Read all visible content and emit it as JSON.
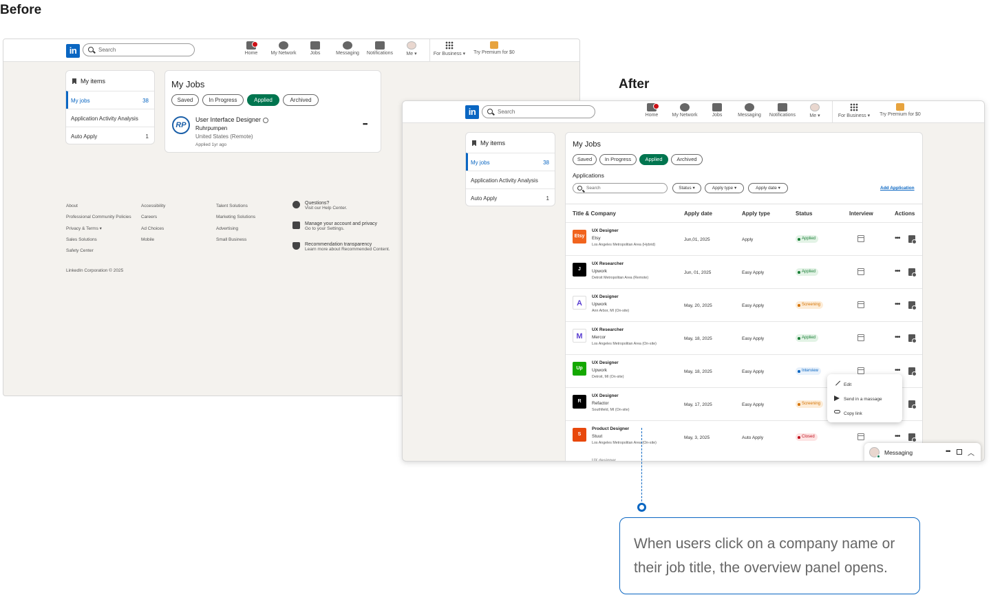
{
  "labels": {
    "before": "Before",
    "after": "After"
  },
  "nav": {
    "search_placeholder": "Search",
    "items": [
      "Home",
      "My Network",
      "Jobs",
      "Messaging",
      "Notifications",
      "Me",
      "For Business",
      "Try Premium for $0"
    ]
  },
  "sidebar": {
    "header": "My items",
    "items": [
      {
        "label": "My jobs",
        "count": "38"
      },
      {
        "label": "Application Activity Analysis",
        "count": ""
      },
      {
        "label": "Auto Apply",
        "count": "1"
      }
    ]
  },
  "jobs": {
    "title": "My Jobs",
    "tabs": [
      "Saved",
      "In Progress",
      "Applied",
      "Archived"
    ],
    "active_tab": "Applied"
  },
  "before_job": {
    "logo_text": "RP",
    "title": "User Interface Designer",
    "company": "Ruhrpumpen",
    "location": "United States (Remote)",
    "applied": "Applied 1yr ago",
    "more": "•••"
  },
  "footer": {
    "col1": [
      "About",
      "Professional Community Policies",
      "Privacy & Terms",
      "Sales Solutions",
      "Safety Center"
    ],
    "col2": [
      "Accessibility",
      "Careers",
      "Ad Choices",
      "Mobile"
    ],
    "col3": [
      "Talent Solutions",
      "Marketing Solutions",
      "Advertising",
      "Small Business"
    ],
    "help": [
      {
        "title": "Questions?",
        "sub": "Visit our Help Center."
      },
      {
        "title": "Manage your account and privacy",
        "sub": "Go to your Settings."
      },
      {
        "title": "Recommendation transparency",
        "sub": "Learn more about Recommended Content."
      }
    ],
    "copyright": "LinkedIn Corporation © 2025"
  },
  "applications": {
    "heading": "Applications",
    "search_placeholder": "Search",
    "filters": [
      "Status",
      "Apply type",
      "Apply date"
    ],
    "add_link": "Add Application",
    "columns": [
      "Title & Company",
      "Apply date",
      "Apply type",
      "Status",
      "Interview",
      "Actions"
    ],
    "rows": [
      {
        "logo": "Etsy",
        "logo_color": "#f1641e",
        "title": "UX Designer",
        "company": "Etsy",
        "location": "Los Angeles Metropolitan Area (Hybrid)",
        "date": "Jun,01, 2025",
        "type": "Apply",
        "status": "Applied",
        "status_kind": "applied"
      },
      {
        "logo": "J",
        "logo_color": "#000000",
        "title": "UX Researcher",
        "company": "Upwork",
        "location": "Detroit Metropolitan Area (Remote)",
        "date": "Jun, 01, 2025",
        "type": "Easy Apply",
        "status": "Applied",
        "status_kind": "applied"
      },
      {
        "logo": "A",
        "logo_color": "#ffffff",
        "title": "UX Designer",
        "company": "Upwork",
        "location": "Ann Arbor, MI  (On-site)",
        "date": "May, 20, 2025",
        "type": "Easy Apply",
        "status": "Screening",
        "status_kind": "screen"
      },
      {
        "logo": "M",
        "logo_color": "#ffffff",
        "title": "UX Researcher",
        "company": "Mercor",
        "location": "Los Angeles Metropolitan Area (On-site)",
        "date": "May, 18, 2025",
        "type": "Easy Apply",
        "status": "Applied",
        "status_kind": "applied"
      },
      {
        "logo": "Up",
        "logo_color": "#14a800",
        "title": "UX Designer",
        "company": "Upwork",
        "location": "Detroit, MI (On-site)",
        "date": "May, 18, 2025",
        "type": "Easy Apply",
        "status": "Interview",
        "status_kind": "int"
      },
      {
        "logo": "R",
        "logo_color": "#000000",
        "title": "UX Designer",
        "company": "Refactor",
        "location": "Southfield, MI (On-site)",
        "date": "May, 17, 2025",
        "type": "Easy Apply",
        "status": "Screening",
        "status_kind": "screen"
      },
      {
        "logo": "S",
        "logo_color": "#e8480c",
        "title": "Product Designer",
        "company": "Stuut",
        "location": "Los Angeles Metropolitan Area (On-site)",
        "date": "May, 3, 2025",
        "type": "Auto Apply",
        "status": "Closed",
        "status_kind": "closed"
      }
    ]
  },
  "action_menu": [
    "Edit",
    "Send in a massage",
    "Copy link"
  ],
  "messaging": {
    "label": "Messaging"
  },
  "callout": {
    "text": "When users click on a company name or their job title, the overview panel opens."
  },
  "colors": {
    "linkedin_blue": "#0a66c2",
    "applied_green": "#01754f",
    "page_bg": "#f4f2ee"
  }
}
